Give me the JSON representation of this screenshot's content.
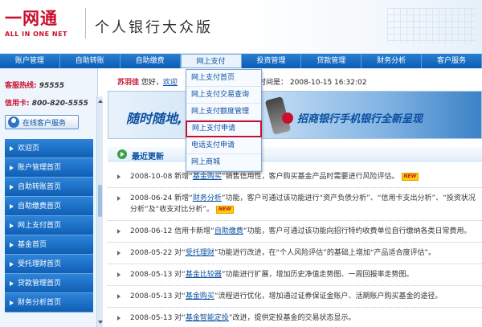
{
  "header": {
    "logo_main": "一网通",
    "logo_sub": "ALL IN ONE NET",
    "site_title": "个人银行大众版"
  },
  "nav": {
    "items": [
      "账户管理",
      "自助转账",
      "自助缴费",
      "网上支付",
      "投资管理",
      "贷款管理",
      "财务分析",
      "客户服务"
    ],
    "active": "网上支付"
  },
  "sidebar": {
    "hotline_label": "客服热线:",
    "hotline_value": "95555",
    "card_label": "信用卡:",
    "card_value": "800-820-5555",
    "online_service": "在线客户服务",
    "items": [
      {
        "label": "欢迎页"
      },
      {
        "label": "账户管理首页"
      },
      {
        "label": "自助转账首页"
      },
      {
        "label": "自助缴费首页"
      },
      {
        "label": "网上支付首页"
      },
      {
        "label": "基金首页"
      },
      {
        "label": "受托理财首页"
      },
      {
        "label": "贷款管理首页"
      },
      {
        "label": "财务分析首页"
      }
    ]
  },
  "main": {
    "user_name": "苏羽佳",
    "greeting_suffix": "您好，",
    "greeting_link": "欢迎",
    "login_time_label": "时间是：",
    "login_time": "2008-10-15 16:32:02",
    "banner_text1": "随时随地,",
    "banner_text2": "招商银行手机银行全新呈现",
    "section_title": "最近更新",
    "new_badge": "NEW",
    "news": [
      {
        "pre": "2008-10-08 新增“",
        "link": "基金购买",
        "post": "”销售信用性，客户购买基金产品时需要进行风险评估。",
        "new": true
      },
      {
        "pre": "2008-06-24 新增“",
        "link": "财务分析",
        "post": "”功能，客户可通过该功能进行“资产负债分析”、“信用卡支出分析”、“投资状况分析”及“收支对比分析”。",
        "new": true
      },
      {
        "pre": "2008-06-12 信用卡新增“",
        "link": "自助缴费",
        "post": "”功能，客户可通过该功能向招行特约收费单位自行缴纳各类日常费用。",
        "new": false
      },
      {
        "pre": "2008-05-22 对“",
        "link": "受托理财",
        "post": "”功能进行改进，在“个人风险评估”的基础上增加“产品适合度评估”。",
        "new": false
      },
      {
        "pre": "2008-05-13 对“",
        "link": "基金比较器",
        "post": "”功能进行扩展，增加历史净值走势图、一周回报率走势图。",
        "new": false
      },
      {
        "pre": "2008-05-13 对“",
        "link": "基金购买",
        "post": "”流程进行优化，增加通过证券保证金账户、活期账户购买基金的途径。",
        "new": false
      },
      {
        "pre": "2008-05-13 对“",
        "link": "基金智能定投",
        "post": "”改进，提供定投基金的交易状态显示。",
        "new": false
      }
    ]
  },
  "dropdown": {
    "items": [
      "网上支付首页",
      "网上支付交易查询",
      "网上支付额度管理",
      "网上支付申请",
      "电话支付申请",
      "网上商城"
    ],
    "selected_index": 3
  }
}
